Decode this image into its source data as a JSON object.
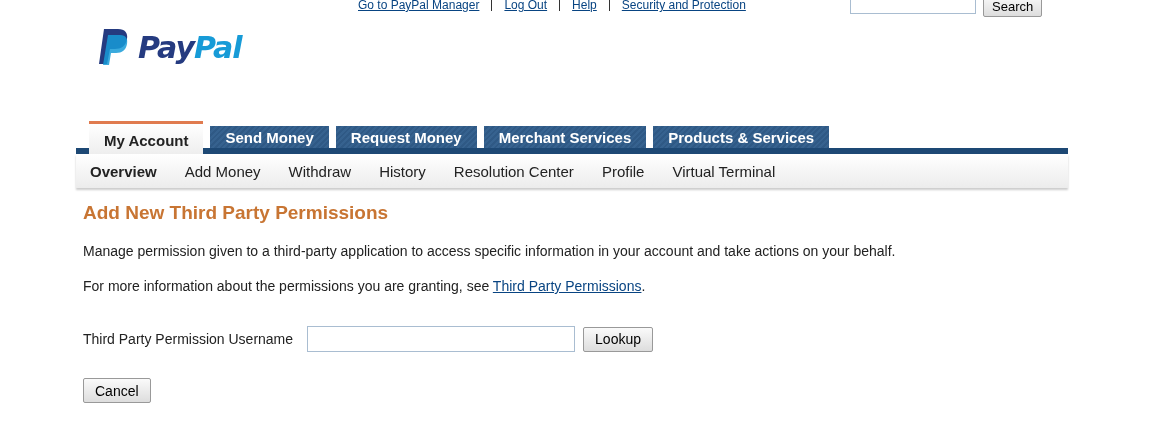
{
  "top_links": [
    "Go to PayPal Manager",
    "Log Out",
    "Help",
    "Security and Protection"
  ],
  "search": {
    "button": "Search"
  },
  "logo": {
    "text_dark": "Pay",
    "text_light": "Pal"
  },
  "tabs": [
    {
      "label": "My Account",
      "selected": true
    },
    {
      "label": "Send Money",
      "selected": false
    },
    {
      "label": "Request Money",
      "selected": false
    },
    {
      "label": "Merchant Services",
      "selected": false
    },
    {
      "label": "Products & Services",
      "selected": false
    }
  ],
  "subnav": [
    {
      "label": "Overview",
      "selected": true
    },
    {
      "label": "Add Money",
      "selected": false
    },
    {
      "label": "Withdraw",
      "selected": false
    },
    {
      "label": "History",
      "selected": false
    },
    {
      "label": "Resolution Center",
      "selected": false
    },
    {
      "label": "Profile",
      "selected": false
    },
    {
      "label": "Virtual Terminal",
      "selected": false
    }
  ],
  "heading": "Add New Third Party Permissions",
  "intro": "Manage permission given to a third-party application to access specific information in your account and take actions on your behalf.",
  "info": {
    "text": "For more information about the permissions you are granting, see ",
    "link": "Third Party Permissions",
    "after": "."
  },
  "username_field": {
    "label": "Third Party Permission Username",
    "button": "Lookup"
  },
  "cancel_button": "Cancel"
}
